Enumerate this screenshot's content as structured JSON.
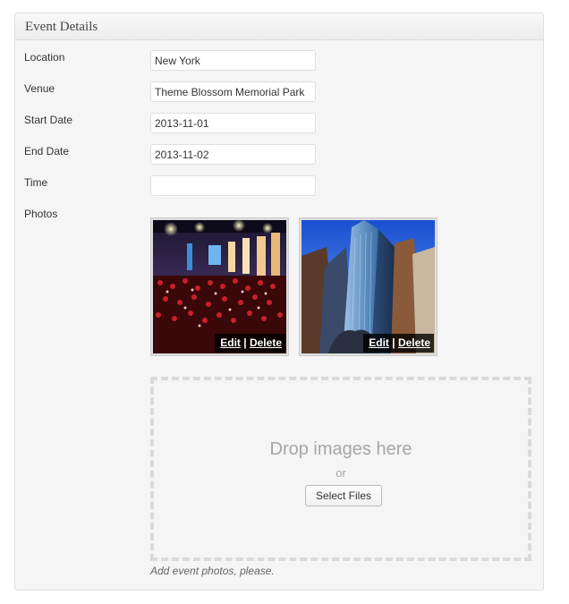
{
  "box": {
    "title": "Event Details"
  },
  "fields": [
    {
      "label": "Location",
      "value": "New York"
    },
    {
      "label": "Venue",
      "value": "Theme Blossom Memorial Park"
    },
    {
      "label": "Start Date",
      "value": "2013-11-01"
    },
    {
      "label": "End Date",
      "value": "2013-11-02"
    },
    {
      "label": "Time",
      "value": ""
    }
  ],
  "photos": {
    "label": "Photos",
    "items": [
      {
        "edit": "Edit",
        "separator": "|",
        "delete": "Delete"
      },
      {
        "edit": "Edit",
        "separator": "|",
        "delete": "Delete"
      }
    ]
  },
  "dropzone": {
    "title": "Drop images here",
    "or": "or",
    "button": "Select Files"
  },
  "hint": "Add event photos, please."
}
